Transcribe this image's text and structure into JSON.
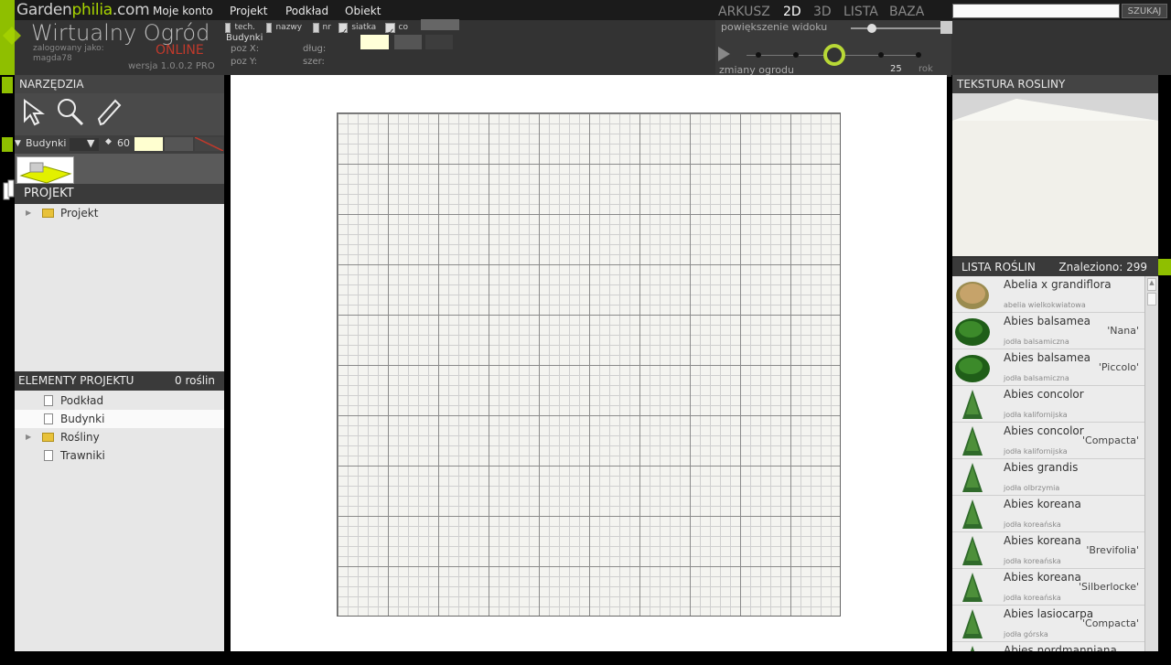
{
  "topmenu": {
    "logo_prefix": "Garden",
    "logo_highlight": "philia",
    "logo_suffix": ".com",
    "items": [
      "Moje konto",
      "Projekt",
      "Podkład",
      "Obiekt"
    ]
  },
  "header": {
    "title": "Wirtualny Ogród",
    "online": "ONLINE",
    "logged_label": "zalogowany jako:",
    "username": "magda78",
    "version": "wersja 1.0.0.2 PRO",
    "toggles": [
      {
        "label": "tech.",
        "checked": false
      },
      {
        "label": "nazwy",
        "checked": false
      },
      {
        "label": "nr",
        "checked": false
      },
      {
        "label": "siatka",
        "checked": true
      },
      {
        "label": "co",
        "checked": true
      }
    ],
    "object_name": "Budynki",
    "poz_x": "poz X:",
    "poz_y": "poz Y:",
    "dlug": "dług:",
    "szer": "szer:"
  },
  "view": {
    "tabs": [
      "ARKUSZ",
      "2D",
      "3D",
      "LISTA",
      "BAZA"
    ],
    "active": "2D",
    "zoom_label": "powiększenie widoku",
    "zoom_level": 0.22,
    "changes_label": "zmiany ogrodu",
    "years_value": "25",
    "years_unit": "rok"
  },
  "search": {
    "placeholder": "",
    "button": "SZUKAJ"
  },
  "left": {
    "tools_title": "NARZĘDZIA",
    "layer": "Budynki",
    "layer_value": "60",
    "project_title": "PROJEKT",
    "project_tree": [
      {
        "label": "Projekt",
        "type": "folder"
      }
    ],
    "elements_title": "ELEMENTY PROJEKTU",
    "elements_count": "0 roślin",
    "elements": [
      {
        "label": "Podkład",
        "type": "doc"
      },
      {
        "label": "Budynki",
        "type": "doc",
        "selected": true
      },
      {
        "label": "Rośliny",
        "type": "folder"
      },
      {
        "label": "Trawniki",
        "type": "doc"
      }
    ]
  },
  "right": {
    "texture_title": "TEKSTURA ROSLINY",
    "list_title": "LISTA ROŚLIN",
    "found": "Znaleziono: 299",
    "plants": [
      {
        "name": "Abelia x grandiflora",
        "sub": "abelia wielkokwiatowa",
        "variety": "",
        "icon": "shrub-flowering"
      },
      {
        "name": "Abies balsamea",
        "sub": "jodła balsamiczna",
        "variety": "'Nana'",
        "icon": "shrub-round"
      },
      {
        "name": "Abies balsamea",
        "sub": "jodła balsamiczna",
        "variety": "'Piccolo'",
        "icon": "shrub-round"
      },
      {
        "name": "Abies concolor",
        "sub": "jodła kalifornijska",
        "variety": "",
        "icon": "conifer"
      },
      {
        "name": "Abies concolor",
        "sub": "jodła kalifornijska",
        "variety": "'Compacta'",
        "icon": "conifer"
      },
      {
        "name": "Abies grandis",
        "sub": "jodła olbrzymia",
        "variety": "",
        "icon": "conifer"
      },
      {
        "name": "Abies koreana",
        "sub": "jodła koreańska",
        "variety": "",
        "icon": "conifer"
      },
      {
        "name": "Abies koreana",
        "sub": "jodła koreańska",
        "variety": "'Brevifolia'",
        "icon": "conifer"
      },
      {
        "name": "Abies koreana",
        "sub": "jodła koreańska",
        "variety": "'Silberlocke'",
        "icon": "conifer"
      },
      {
        "name": "Abies lasiocarpa",
        "sub": "jodła górska",
        "variety": "'Compacta'",
        "icon": "conifer"
      },
      {
        "name": "Abies nordmanniana",
        "sub": "",
        "variety": "",
        "icon": "conifer"
      }
    ]
  },
  "colors": {
    "accent": "#8fbf00",
    "online": "#c0392b"
  }
}
